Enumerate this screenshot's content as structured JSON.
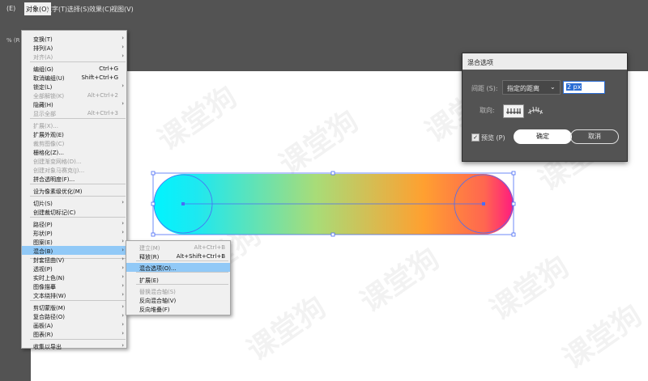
{
  "menubar": {
    "items": [
      "(E)",
      "对象(O)",
      "文字(T)",
      "选择(S)",
      "效果(C)",
      "视图(V)"
    ]
  },
  "toolbar2": {
    "text": "% (R"
  },
  "object_menu": {
    "items": [
      {
        "label": "变换(T)",
        "shortcut": "",
        "arrow": true,
        "disabled": false
      },
      {
        "label": "排列(A)",
        "shortcut": "",
        "arrow": true,
        "disabled": false
      },
      {
        "label": "对齐(A)",
        "shortcut": "",
        "arrow": true,
        "disabled": true
      },
      {
        "label": "编组(G)",
        "shortcut": "Ctrl+G",
        "arrow": false,
        "disabled": false
      },
      {
        "label": "取消编组(U)",
        "shortcut": "Shift+Ctrl+G",
        "arrow": false,
        "disabled": false
      },
      {
        "label": "锁定(L)",
        "shortcut": "",
        "arrow": true,
        "disabled": false
      },
      {
        "label": "全部解锁(K)",
        "shortcut": "Alt+Ctrl+2",
        "arrow": false,
        "disabled": true
      },
      {
        "label": "隐藏(H)",
        "shortcut": "",
        "arrow": true,
        "disabled": false
      },
      {
        "label": "显示全部",
        "shortcut": "Alt+Ctrl+3",
        "arrow": false,
        "disabled": true
      },
      {
        "label": "扩展(X)...",
        "shortcut": "",
        "arrow": false,
        "disabled": true
      },
      {
        "label": "扩展外观(E)",
        "shortcut": "",
        "arrow": false,
        "disabled": false
      },
      {
        "label": "裁剪图像(C)",
        "shortcut": "",
        "arrow": false,
        "disabled": true
      },
      {
        "label": "栅格化(Z)...",
        "shortcut": "",
        "arrow": false,
        "disabled": false
      },
      {
        "label": "创建渐变网格(D)...",
        "shortcut": "",
        "arrow": false,
        "disabled": true
      },
      {
        "label": "创建对象马赛克(J)...",
        "shortcut": "",
        "arrow": false,
        "disabled": true
      },
      {
        "label": "拼合透明度(F)...",
        "shortcut": "",
        "arrow": false,
        "disabled": false
      },
      {
        "label": "设为像素级优化(M)",
        "shortcut": "",
        "arrow": false,
        "disabled": false
      },
      {
        "label": "切片(S)",
        "shortcut": "",
        "arrow": true,
        "disabled": false
      },
      {
        "label": "创建裁切标记(C)",
        "shortcut": "",
        "arrow": false,
        "disabled": false
      },
      {
        "label": "路径(P)",
        "shortcut": "",
        "arrow": true,
        "disabled": false
      },
      {
        "label": "形状(P)",
        "shortcut": "",
        "arrow": true,
        "disabled": false
      },
      {
        "label": "图案(E)",
        "shortcut": "",
        "arrow": true,
        "disabled": false
      },
      {
        "label": "混合(B)",
        "shortcut": "",
        "arrow": true,
        "disabled": false
      },
      {
        "label": "封套扭曲(V)",
        "shortcut": "",
        "arrow": true,
        "disabled": false
      },
      {
        "label": "透视(P)",
        "shortcut": "",
        "arrow": true,
        "disabled": false
      },
      {
        "label": "实时上色(N)",
        "shortcut": "",
        "arrow": true,
        "disabled": false
      },
      {
        "label": "图像描摹",
        "shortcut": "",
        "arrow": true,
        "disabled": false
      },
      {
        "label": "文本绕排(W)",
        "shortcut": "",
        "arrow": true,
        "disabled": false
      },
      {
        "label": "剪切蒙版(M)",
        "shortcut": "",
        "arrow": true,
        "disabled": false
      },
      {
        "label": "复合路径(O)",
        "shortcut": "",
        "arrow": true,
        "disabled": false
      },
      {
        "label": "画板(A)",
        "shortcut": "",
        "arrow": true,
        "disabled": false
      },
      {
        "label": "图表(R)",
        "shortcut": "",
        "arrow": true,
        "disabled": false
      },
      {
        "label": "收集以导出",
        "shortcut": "",
        "arrow": true,
        "disabled": false
      }
    ]
  },
  "blend_submenu": {
    "items": [
      {
        "label": "建立(M)",
        "shortcut": "Alt+Ctrl+B",
        "disabled": true
      },
      {
        "label": "释放(R)",
        "shortcut": "Alt+Shift+Ctrl+B",
        "disabled": false
      },
      {
        "label": "混合选项(O)...",
        "shortcut": "",
        "disabled": false
      },
      {
        "label": "扩展(E)",
        "shortcut": "",
        "disabled": false
      },
      {
        "label": "替换混合轴(S)",
        "shortcut": "",
        "disabled": true
      },
      {
        "label": "反向混合轴(V)",
        "shortcut": "",
        "disabled": false
      },
      {
        "label": "反向堆叠(F)",
        "shortcut": "",
        "disabled": false
      }
    ]
  },
  "dialog": {
    "title": "混合选项",
    "spacing_label": "间距 (S):",
    "spacing_mode": "指定的距离",
    "spacing_value": "2 px",
    "orientation_label": "取向:",
    "preview_label": "预览 (P)",
    "preview_checked": "✓",
    "ok_label": "确定",
    "cancel_label": "取消"
  },
  "watermark": "课堂狗",
  "colors": {
    "menu_bg": "#f0f0f0",
    "highlight": "#91c9f7",
    "ui_gray": "#535353",
    "gradient_start": "#00f0ff",
    "gradient_mid": "#9fe070",
    "gradient_orange": "#ff9a30",
    "gradient_end": "#ff1a80",
    "selection_blue": "#4a6cf5"
  }
}
